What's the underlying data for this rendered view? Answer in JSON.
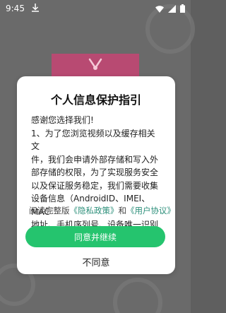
{
  "status_bar": {
    "time": "9:45"
  },
  "dialog": {
    "title": "个人信息保护指引",
    "lines": [
      "感谢您选择我们!",
      "1、为了您浏览视频以及缓存相关文",
      "件，我们会申请外部存储和写入外",
      "部存储的权限，为了实现服务安全",
      "以及保证服务稳定，我们需要收集",
      "设备信息（AndroidID、IMEI、MAC",
      "地址、手机序列号、设备唯一识别"
    ],
    "read_prefix": "阅读完整版",
    "privacy_link": "《隐私政策》",
    "and_text": "和",
    "agreement_link": "《用户协议》",
    "agree_label": "同意并继续",
    "disagree_label": "不同意"
  },
  "colors": {
    "accent_green": "#25c46e",
    "link_color": "#2c8f7a",
    "logo_pink": "#b84a72"
  }
}
